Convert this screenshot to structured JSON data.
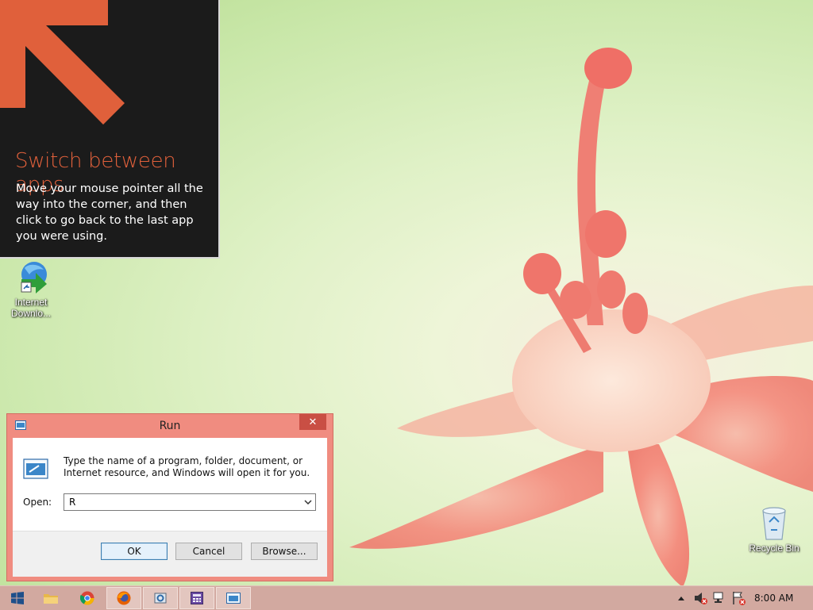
{
  "tip": {
    "title": "Switch between apps",
    "body": "Move your mouse pointer all the way into the corner, and then click to go back to the last app you were using."
  },
  "desktop": {
    "icons": [
      {
        "label": "Internet Downlo...",
        "icon": "internet-download-manager-icon"
      },
      {
        "label": "Recycle Bin",
        "icon": "recycle-bin-icon"
      }
    ]
  },
  "run_dialog": {
    "title": "Run",
    "close_glyph": "✕",
    "description": "Type the name of a program, folder, document, or Internet resource, and Windows will open it for you.",
    "open_label": "Open:",
    "open_value": "R",
    "ok_label": "OK",
    "cancel_label": "Cancel",
    "browse_label": "Browse..."
  },
  "taskbar": {
    "items": [
      {
        "name": "start-button",
        "icon": "windows-logo-icon"
      },
      {
        "name": "file-explorer",
        "icon": "folder-icon"
      },
      {
        "name": "chrome",
        "icon": "chrome-icon"
      },
      {
        "name": "firefox",
        "icon": "firefox-icon"
      },
      {
        "name": "settings-app",
        "icon": "settings-icon"
      },
      {
        "name": "calculator-app",
        "icon": "calculator-icon"
      },
      {
        "name": "run-app",
        "icon": "run-icon"
      }
    ],
    "clock": "8:00 AM"
  },
  "colors": {
    "accent": "#e0603b",
    "dialog_frame": "#f08c80",
    "close_button": "#c94f44",
    "taskbar": "#d2a9a0"
  }
}
